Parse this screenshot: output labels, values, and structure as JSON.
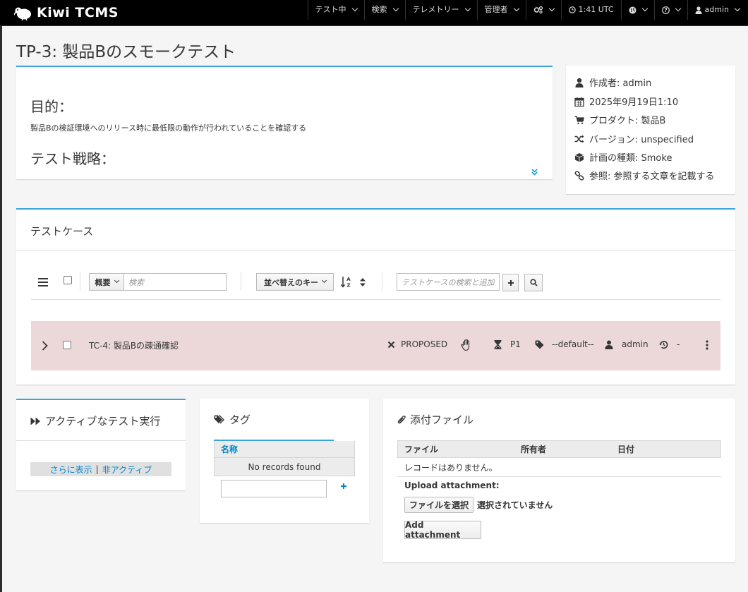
{
  "app": {
    "brand": "Kiwi TCMS"
  },
  "nav": {
    "items": [
      {
        "label": "テスト中"
      },
      {
        "label": "検索"
      },
      {
        "label": "テレメトリー"
      },
      {
        "label": "管理者"
      },
      {
        "label": ""
      },
      {
        "label": "1:41 UTC"
      },
      {
        "label": ""
      },
      {
        "label": ""
      },
      {
        "label": "admin"
      }
    ]
  },
  "page": {
    "title": "TP-3: 製品Bのスモークテスト"
  },
  "description": {
    "purpose_heading": "目的：",
    "purpose_text": "製品Bの検証環境へのリリース時に最低限の動作が行われていることを確認する",
    "strategy_heading": "テスト戦略："
  },
  "meta": {
    "author": "作成者: admin",
    "created": "2025年9月19日1:10",
    "product": "プロダクト: 製品B",
    "version": "バージョン: unspecified",
    "type": "計画の種類: Smoke",
    "reference": "参照: 参照する文章を記載する"
  },
  "testcases": {
    "title": "テストケース",
    "filter_select": "概要",
    "filter_placeholder": "検索",
    "sort_select": "並べ替えのキー",
    "search_add_placeholder": "テストケースの検索と追加",
    "rows": [
      {
        "name": "TC-4: 製品Bの疎通確認",
        "status": "PROPOSED",
        "priority": "P1",
        "category": "--default--",
        "assignee": "admin",
        "history": "-"
      }
    ]
  },
  "active_runs": {
    "title": "アクティブなテスト実行",
    "show_more": "さらに表示",
    "inactive": "非アクティブ",
    "sep": "|"
  },
  "tags": {
    "title": "タグ",
    "column": "名称",
    "empty": "No records found"
  },
  "attachments": {
    "title": "添付ファイル",
    "columns": [
      "ファイル",
      "所有者",
      "日付"
    ],
    "empty": "レコードはありません。",
    "upload_label": "Upload attachment:",
    "choose_file": "ファイルを選択",
    "no_file": "選択されていません",
    "add_button": "Add attachment"
  }
}
